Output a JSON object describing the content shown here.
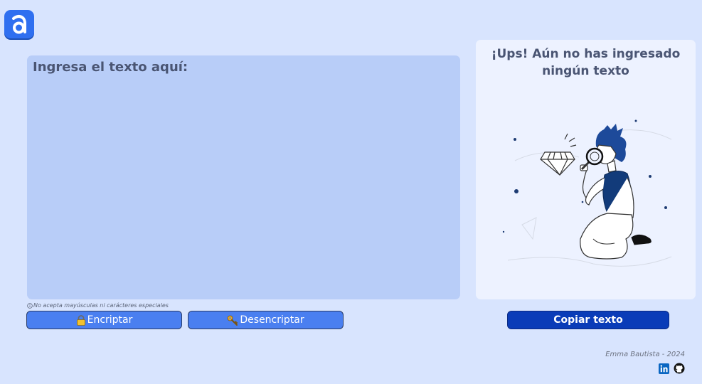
{
  "logo": {
    "letter": "a",
    "icon": "logo-a-icon"
  },
  "input": {
    "placeholder": "Ingresa el texto aquí:",
    "value": ""
  },
  "note": {
    "icon": "info-icon",
    "text": "No acepta mayúsculas ni carácteres especiales"
  },
  "buttons": {
    "encrypt": {
      "label": "Encriptar",
      "icon": "lock-icon"
    },
    "decrypt": {
      "label": "Desencriptar",
      "icon": "key-icon"
    },
    "copy": {
      "label": "Copiar texto"
    }
  },
  "output": {
    "title": "¡Ups! Aún no has ingresado ningún texto",
    "illustration": "person-with-magnifier-illustration"
  },
  "footer": {
    "author": "Emma Bautista - 2024",
    "links": [
      {
        "icon": "linkedin-icon"
      },
      {
        "icon": "github-icon"
      }
    ]
  },
  "colors": {
    "background": "#d8e4fe",
    "input_panel": "#b8cdf8",
    "output_panel": "#edf2ff",
    "primary_button": "#4a7ff0",
    "copy_button": "#0a3cb8",
    "brand": "#2f6ff0"
  }
}
